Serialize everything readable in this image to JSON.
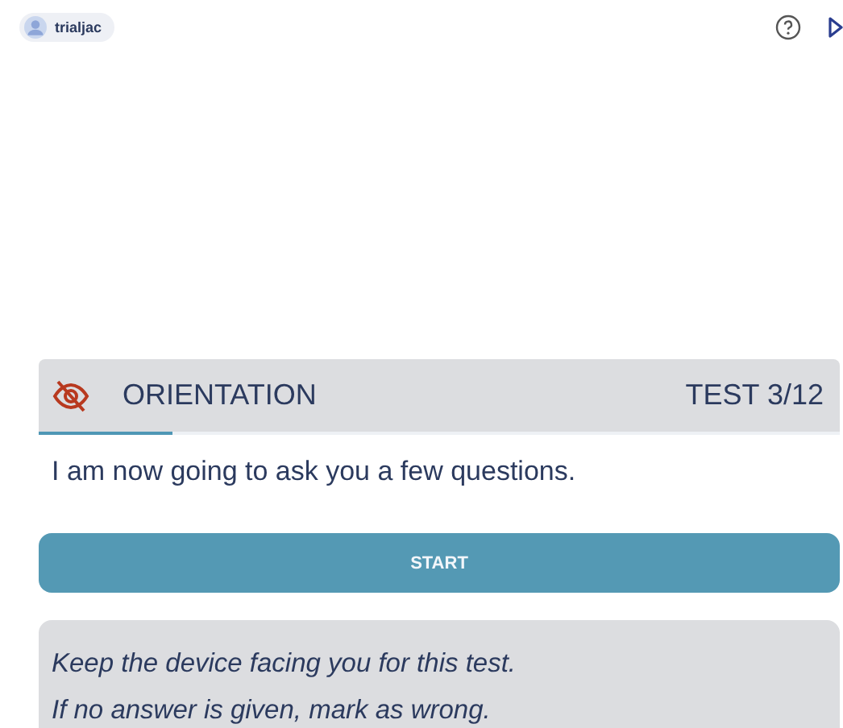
{
  "user": {
    "name": "trialjac"
  },
  "test": {
    "section": "ORIENTATION",
    "counter": "TEST 3/12",
    "progress": {
      "level": 0.167
    }
  },
  "prompt": "I am now going to ask you a few questions.",
  "start_button": "START",
  "note": [
    "Keep the device facing you for this test.",
    "If no answer is given, mark as wrong."
  ]
}
